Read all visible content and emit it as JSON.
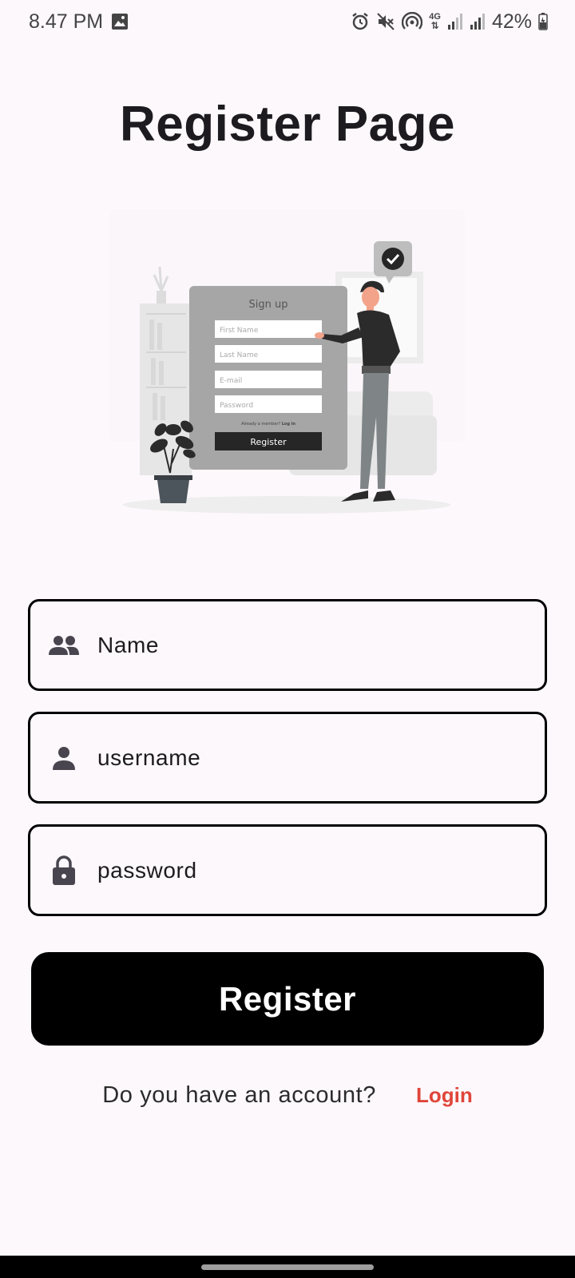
{
  "status_bar": {
    "time": "8.47 PM",
    "network": "4G",
    "battery": "42%",
    "icons": [
      "image-icon",
      "alarm-icon",
      "mute-icon",
      "hotspot-icon",
      "signal-icon",
      "signal-icon",
      "battery-icon"
    ]
  },
  "page": {
    "title": "Register Page"
  },
  "illustration": {
    "card_title": "Sign up",
    "fields": [
      "First Name",
      "Last Name",
      "E-mail",
      "Password"
    ],
    "footnote": "Already a member?",
    "footnote_link": "Log in",
    "button": "Register"
  },
  "form": {
    "name": {
      "placeholder": "Name",
      "icon": "people-icon"
    },
    "username": {
      "placeholder": "username",
      "icon": "person-icon"
    },
    "password": {
      "placeholder": "password",
      "icon": "lock-icon"
    },
    "register_label": "Register"
  },
  "footer": {
    "question": "Do you have an account?",
    "login_label": "Login"
  },
  "colors": {
    "background": "#fdf8fc",
    "primary_button": "#000000",
    "link": "#e0453a"
  }
}
